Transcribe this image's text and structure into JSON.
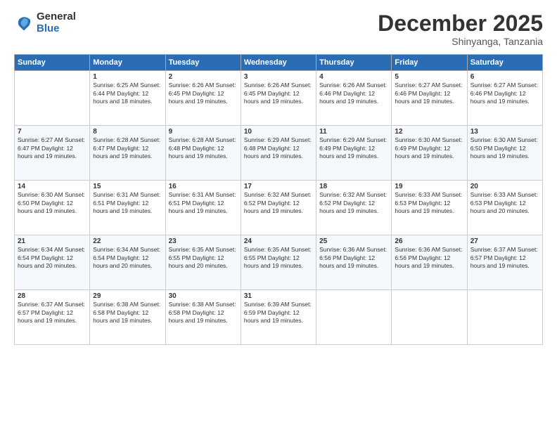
{
  "logo": {
    "general": "General",
    "blue": "Blue"
  },
  "title": "December 2025",
  "subtitle": "Shinyanga, Tanzania",
  "weekdays": [
    "Sunday",
    "Monday",
    "Tuesday",
    "Wednesday",
    "Thursday",
    "Friday",
    "Saturday"
  ],
  "rows": [
    [
      {
        "num": "",
        "info": ""
      },
      {
        "num": "1",
        "info": "Sunrise: 6:25 AM\nSunset: 6:44 PM\nDaylight: 12 hours\nand 18 minutes."
      },
      {
        "num": "2",
        "info": "Sunrise: 6:26 AM\nSunset: 6:45 PM\nDaylight: 12 hours\nand 19 minutes."
      },
      {
        "num": "3",
        "info": "Sunrise: 6:26 AM\nSunset: 6:45 PM\nDaylight: 12 hours\nand 19 minutes."
      },
      {
        "num": "4",
        "info": "Sunrise: 6:26 AM\nSunset: 6:46 PM\nDaylight: 12 hours\nand 19 minutes."
      },
      {
        "num": "5",
        "info": "Sunrise: 6:27 AM\nSunset: 6:46 PM\nDaylight: 12 hours\nand 19 minutes."
      },
      {
        "num": "6",
        "info": "Sunrise: 6:27 AM\nSunset: 6:46 PM\nDaylight: 12 hours\nand 19 minutes."
      }
    ],
    [
      {
        "num": "7",
        "info": "Sunrise: 6:27 AM\nSunset: 6:47 PM\nDaylight: 12 hours\nand 19 minutes."
      },
      {
        "num": "8",
        "info": "Sunrise: 6:28 AM\nSunset: 6:47 PM\nDaylight: 12 hours\nand 19 minutes."
      },
      {
        "num": "9",
        "info": "Sunrise: 6:28 AM\nSunset: 6:48 PM\nDaylight: 12 hours\nand 19 minutes."
      },
      {
        "num": "10",
        "info": "Sunrise: 6:29 AM\nSunset: 6:48 PM\nDaylight: 12 hours\nand 19 minutes."
      },
      {
        "num": "11",
        "info": "Sunrise: 6:29 AM\nSunset: 6:49 PM\nDaylight: 12 hours\nand 19 minutes."
      },
      {
        "num": "12",
        "info": "Sunrise: 6:30 AM\nSunset: 6:49 PM\nDaylight: 12 hours\nand 19 minutes."
      },
      {
        "num": "13",
        "info": "Sunrise: 6:30 AM\nSunset: 6:50 PM\nDaylight: 12 hours\nand 19 minutes."
      }
    ],
    [
      {
        "num": "14",
        "info": "Sunrise: 6:30 AM\nSunset: 6:50 PM\nDaylight: 12 hours\nand 19 minutes."
      },
      {
        "num": "15",
        "info": "Sunrise: 6:31 AM\nSunset: 6:51 PM\nDaylight: 12 hours\nand 19 minutes."
      },
      {
        "num": "16",
        "info": "Sunrise: 6:31 AM\nSunset: 6:51 PM\nDaylight: 12 hours\nand 19 minutes."
      },
      {
        "num": "17",
        "info": "Sunrise: 6:32 AM\nSunset: 6:52 PM\nDaylight: 12 hours\nand 19 minutes."
      },
      {
        "num": "18",
        "info": "Sunrise: 6:32 AM\nSunset: 6:52 PM\nDaylight: 12 hours\nand 19 minutes."
      },
      {
        "num": "19",
        "info": "Sunrise: 6:33 AM\nSunset: 6:53 PM\nDaylight: 12 hours\nand 19 minutes."
      },
      {
        "num": "20",
        "info": "Sunrise: 6:33 AM\nSunset: 6:53 PM\nDaylight: 12 hours\nand 20 minutes."
      }
    ],
    [
      {
        "num": "21",
        "info": "Sunrise: 6:34 AM\nSunset: 6:54 PM\nDaylight: 12 hours\nand 20 minutes."
      },
      {
        "num": "22",
        "info": "Sunrise: 6:34 AM\nSunset: 6:54 PM\nDaylight: 12 hours\nand 20 minutes."
      },
      {
        "num": "23",
        "info": "Sunrise: 6:35 AM\nSunset: 6:55 PM\nDaylight: 12 hours\nand 20 minutes."
      },
      {
        "num": "24",
        "info": "Sunrise: 6:35 AM\nSunset: 6:55 PM\nDaylight: 12 hours\nand 19 minutes."
      },
      {
        "num": "25",
        "info": "Sunrise: 6:36 AM\nSunset: 6:56 PM\nDaylight: 12 hours\nand 19 minutes."
      },
      {
        "num": "26",
        "info": "Sunrise: 6:36 AM\nSunset: 6:56 PM\nDaylight: 12 hours\nand 19 minutes."
      },
      {
        "num": "27",
        "info": "Sunrise: 6:37 AM\nSunset: 6:57 PM\nDaylight: 12 hours\nand 19 minutes."
      }
    ],
    [
      {
        "num": "28",
        "info": "Sunrise: 6:37 AM\nSunset: 6:57 PM\nDaylight: 12 hours\nand 19 minutes."
      },
      {
        "num": "29",
        "info": "Sunrise: 6:38 AM\nSunset: 6:58 PM\nDaylight: 12 hours\nand 19 minutes."
      },
      {
        "num": "30",
        "info": "Sunrise: 6:38 AM\nSunset: 6:58 PM\nDaylight: 12 hours\nand 19 minutes."
      },
      {
        "num": "31",
        "info": "Sunrise: 6:39 AM\nSunset: 6:59 PM\nDaylight: 12 hours\nand 19 minutes."
      },
      {
        "num": "",
        "info": ""
      },
      {
        "num": "",
        "info": ""
      },
      {
        "num": "",
        "info": ""
      }
    ]
  ]
}
